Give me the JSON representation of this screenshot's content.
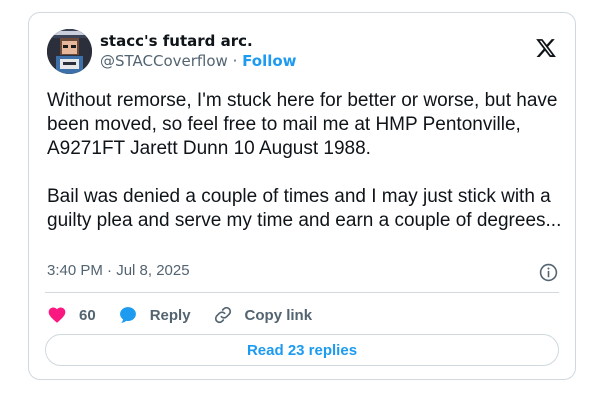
{
  "author": {
    "display_name": "stacc's futard arc.",
    "handle": "@STACCoverflow",
    "separator": " · ",
    "follow_label": "Follow"
  },
  "tweet": {
    "text": "Without remorse, I'm stuck here for better or worse, but have been moved, so feel free to mail me at HMP Pentonville, A9271FT Jarett Dunn 10 August 1988.\n\nBail was denied a couple of times and I may just stick with a guilty plea and serve my time and earn a couple of degrees...",
    "timestamp": "3:40 PM · Jul 8, 2025"
  },
  "actions": {
    "like_count": "60",
    "reply_label": "Reply",
    "copy_link_label": "Copy link"
  },
  "read_replies_label": "Read 23 replies",
  "colors": {
    "like": "#f91880",
    "reply_bubble": "#1d9bf0",
    "link": "#1d9bf0",
    "border": "#cfd9de",
    "text": "#0f1419",
    "muted": "#536471"
  },
  "icons": {
    "brand": "x-logo-icon",
    "like": "heart-icon",
    "reply": "speech-bubble-icon",
    "copy": "link-icon",
    "info": "info-icon"
  }
}
